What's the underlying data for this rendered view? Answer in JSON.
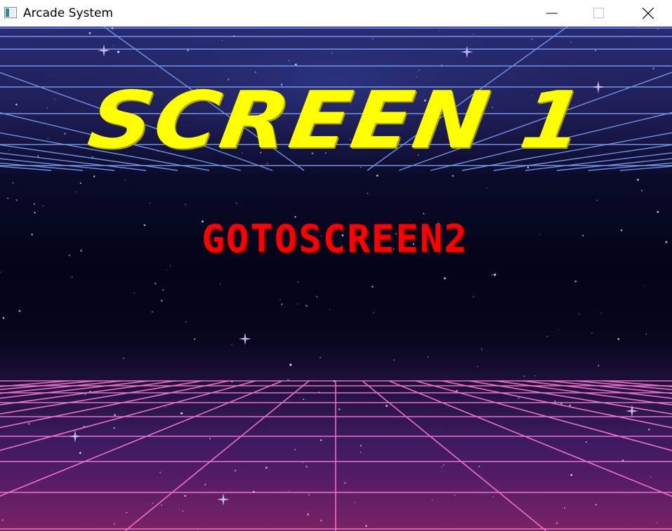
{
  "window": {
    "title": "Arcade System",
    "app_icon": "window-app-icon",
    "controls": {
      "minimize_icon": "minimize-icon",
      "maximize_icon": "maximize-icon",
      "close_icon": "close-icon"
    }
  },
  "game": {
    "screen_title": "SCREEN 1",
    "goto_button_label": "GOTOSCREEN2",
    "colors": {
      "title": "#ffff00",
      "button": "#ff0000",
      "grid_top": "#7fa8ff",
      "grid_bottom": "#ff7ad6"
    }
  }
}
